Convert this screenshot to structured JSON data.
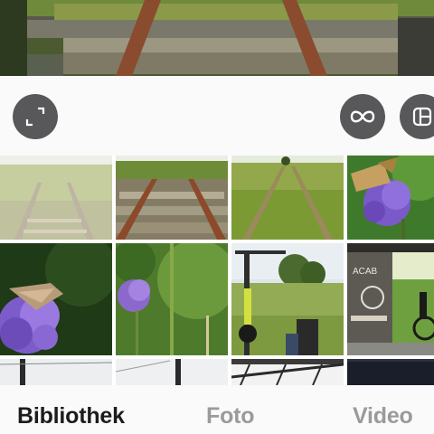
{
  "preview": {
    "image": "railway-track-sleepers-close-up"
  },
  "toolbar": {
    "expand_icon": "expand-arrows-icon",
    "loop_icon": "infinity-loop-icon",
    "layout_icon": "layout-collage-icon",
    "button_color": "#58585a"
  },
  "grid": {
    "tiles": [
      {
        "image": "railway-field-faded"
      },
      {
        "image": "railway-sleepers-meadow"
      },
      {
        "image": "railway-grass-overgrown"
      },
      {
        "image": "butterfly-on-purple-flower"
      },
      {
        "image": "moth-on-purple-scabious"
      },
      {
        "image": "purple-flower-green-background"
      },
      {
        "image": "bicycle-in-field"
      },
      {
        "image": "graffiti-underpass-bmx"
      },
      {
        "image": "power-line-pole-sky"
      },
      {
        "image": "power-line-pole-sky-2"
      },
      {
        "image": "metal-bridge-structure"
      },
      {
        "image": "dark-photo"
      }
    ]
  },
  "tabbar": {
    "library_label": "Bibliothek",
    "photo_label": "Foto",
    "video_label": "Video",
    "active_color": "#1c1c1e",
    "inactive_color": "#9a9a9e"
  }
}
